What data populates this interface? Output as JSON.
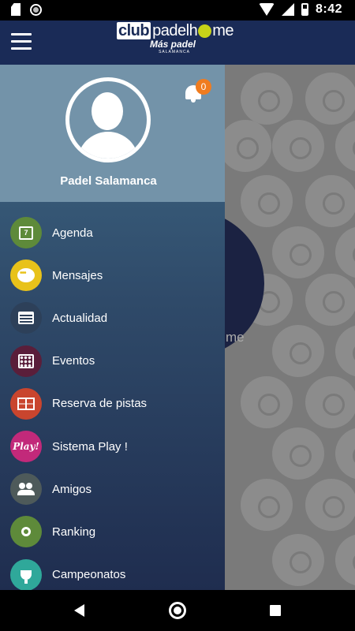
{
  "status_bar": {
    "time": "8:42",
    "icons": [
      "sd-card-icon",
      "recording-icon",
      "wifi-icon",
      "signal-icon",
      "battery-charging-icon"
    ]
  },
  "app_bar": {
    "logo": {
      "club": "club",
      "padel": "padel",
      "h": "h",
      "me": "me",
      "sub": "Más padel",
      "subsub": "SALAMANCA"
    },
    "colors": {
      "background": "#1a2b57",
      "accent": "#c7d318"
    }
  },
  "drawer": {
    "profile_name": "Padel Salamanca",
    "notification_count": "0",
    "items": [
      {
        "label": "Agenda",
        "icon": "calendar-icon",
        "icon_text": "7",
        "color": "#5e8a3a"
      },
      {
        "label": "Mensajes",
        "icon": "chat-icon",
        "icon_text": "",
        "color": "#e8c21a"
      },
      {
        "label": "Actualidad",
        "icon": "newspaper-icon",
        "icon_text": "",
        "color": "#2d4059"
      },
      {
        "label": "Eventos",
        "icon": "events-calendar-icon",
        "icon_text": "",
        "color": "#5a1e3a"
      },
      {
        "label": "Reserva de pistas",
        "icon": "court-icon",
        "icon_text": "",
        "color": "#c9452e"
      },
      {
        "label": "Sistema Play !",
        "icon": "play-icon",
        "icon_text": "Play!",
        "color": "#c2297a"
      },
      {
        "label": "Amigos",
        "icon": "friends-icon",
        "icon_text": "",
        "color": "#4e5a5a"
      },
      {
        "label": "Ranking",
        "icon": "medal-icon",
        "icon_text": "",
        "color": "#5e8a3a"
      },
      {
        "label": "Campeonatos",
        "icon": "trophy-icon",
        "icon_text": "",
        "color": "#2fa89a"
      }
    ]
  },
  "background": {
    "partial_text": "me"
  }
}
